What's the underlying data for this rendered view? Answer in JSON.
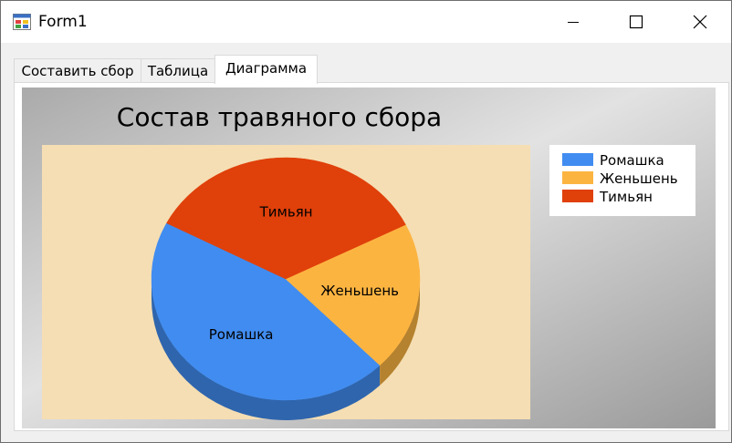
{
  "window": {
    "title": "Form1",
    "minimize_icon": "minimize-icon",
    "maximize_icon": "maximize-icon",
    "close_icon": "close-icon"
  },
  "tabs": [
    {
      "label": "Составить сбор",
      "active": false
    },
    {
      "label": "Таблица",
      "active": false
    },
    {
      "label": "Диаграмма",
      "active": true
    }
  ],
  "chart_data": {
    "type": "pie",
    "title": "Состав травяного сбора",
    "categories": [
      "Ромашка",
      "Женьшень",
      "Тимьян"
    ],
    "values": [
      45,
      20,
      35
    ],
    "colors": [
      "#418cf0",
      "#fcb441",
      "#e0400a"
    ],
    "legend": "top-right",
    "data_labels": [
      "Ромашка",
      "Женьшень",
      "Тимьян"
    ],
    "plot_background": "#f5deb3",
    "style_3d": true
  }
}
